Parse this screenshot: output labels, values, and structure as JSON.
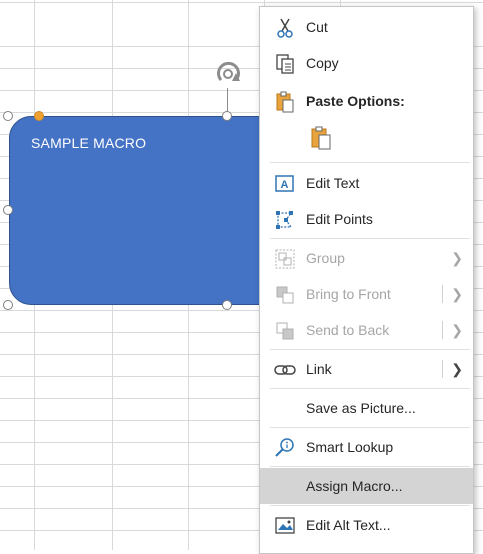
{
  "shape": {
    "text": "SAMPLE MACRO",
    "fill_color": "#4472c4"
  },
  "context_menu": {
    "items": {
      "cut": "Cut",
      "copy": "Copy",
      "paste_options": "Paste Options:",
      "edit_text": "Edit Text",
      "edit_points": "Edit Points",
      "group": "Group",
      "bring_to_front": "Bring to Front",
      "send_to_back": "Send to Back",
      "link": "Link",
      "save_as_picture": "Save as Picture...",
      "smart_lookup": "Smart Lookup",
      "assign_macro": "Assign Macro...",
      "edit_alt_text": "Edit Alt Text..."
    },
    "highlighted_item": "assign_macro",
    "disabled_items": [
      "group",
      "bring_to_front",
      "send_to_back"
    ]
  }
}
